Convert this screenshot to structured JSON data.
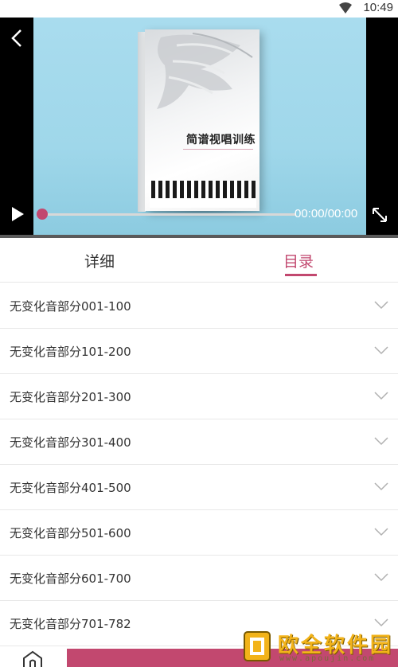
{
  "status_bar": {
    "time": "10:49",
    "wifi_icon": "wifi-icon"
  },
  "player": {
    "book_title": "简谱视唱训练",
    "time_readout": "00:00/00:00",
    "progress": 0,
    "accent_color": "#c2486f",
    "icons": {
      "back": "chevron-left-icon",
      "play": "play-icon",
      "fullscreen": "fullscreen-icon"
    }
  },
  "tabs": [
    {
      "label": "详细",
      "active": false
    },
    {
      "label": "目录",
      "active": true
    }
  ],
  "catalog": [
    {
      "label": "无变化音部分001-100"
    },
    {
      "label": "无变化音部分101-200"
    },
    {
      "label": "无变化音部分201-300"
    },
    {
      "label": "无变化音部分301-400"
    },
    {
      "label": "无变化音部分401-500"
    },
    {
      "label": "无变化音部分501-600"
    },
    {
      "label": "无变化音部分601-700"
    },
    {
      "label": "无变化音部分701-782"
    }
  ],
  "watermark": {
    "text": "欧全软件园",
    "url": "www.apoujin.com"
  }
}
